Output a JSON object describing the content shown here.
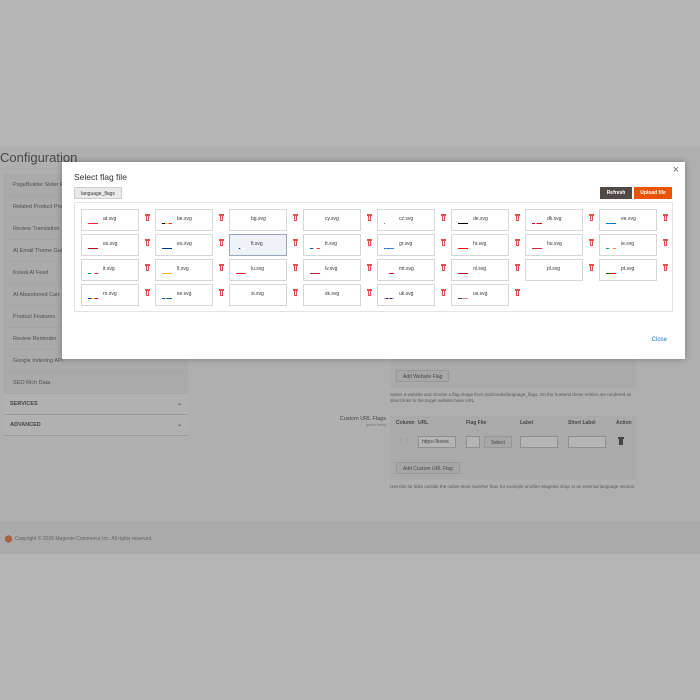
{
  "page": {
    "title": "Configuration",
    "sidebar_items": [
      "PageBuilder Slider F",
      "Related Product Pro",
      "Review Translation",
      "AI Email Theme Gen",
      "Kowal AI Feed",
      "AI Abandoned Cart",
      "Product Features",
      "Review Reminder",
      "Google Indexing API",
      "SEO Rich Data"
    ],
    "sidebar_sections": [
      "SERVICES",
      "ADVANCED"
    ],
    "add_website_flag": "Add Website Flag",
    "website_flag_hint": "Select a website and choose a flag image from pub/media/language_flags. On the frontend these entries are rendered as direct links to the target website base URL.",
    "custom_flags_label": "Custom URL Flags",
    "custom_flags_scope": "[store view]",
    "table_headers": [
      "Column",
      "URL",
      "Flag File",
      "Label",
      "Short Label",
      "Action"
    ],
    "url_value": "https://kowa",
    "select_label": "Select",
    "add_custom_flag": "Add Custom URL Flag",
    "custom_flag_hint": "Use this for links outside the native store switcher flow, for example another Magento shop or an external language version.",
    "copyright": "Copyright © 2026 Magento Commerce Inc. All rights reserved."
  },
  "modal": {
    "title": "Select flag file",
    "folder": "language_flags",
    "refresh_label": "Refresh",
    "upload_label": "Upload file",
    "close_label": "Close",
    "close_icon": "×",
    "selected_file": "fi.svg",
    "files": [
      {
        "name": "at.svg",
        "flag": "at"
      },
      {
        "name": "be.svg",
        "flag": "be"
      },
      {
        "name": "bg.svg",
        "flag": "bg"
      },
      {
        "name": "cy.svg",
        "flag": "cy"
      },
      {
        "name": "cz.svg",
        "flag": "cz"
      },
      {
        "name": "de.svg",
        "flag": "de"
      },
      {
        "name": "dk.svg",
        "flag": "dk"
      },
      {
        "name": "ee.svg",
        "flag": "ee"
      },
      {
        "name": "es.svg",
        "flag": "es"
      },
      {
        "name": "eu.svg",
        "flag": "eu"
      },
      {
        "name": "fi.svg",
        "flag": "fi"
      },
      {
        "name": "fr.svg",
        "flag": "fr"
      },
      {
        "name": "gr.svg",
        "flag": "gr"
      },
      {
        "name": "hr.svg",
        "flag": "hr"
      },
      {
        "name": "hu.svg",
        "flag": "hu"
      },
      {
        "name": "ie.svg",
        "flag": "ie"
      },
      {
        "name": "it.svg",
        "flag": "it"
      },
      {
        "name": "lt.svg",
        "flag": "lt"
      },
      {
        "name": "lu.svg",
        "flag": "lu"
      },
      {
        "name": "lv.svg",
        "flag": "lv"
      },
      {
        "name": "mt.svg",
        "flag": "mt"
      },
      {
        "name": "nl.svg",
        "flag": "nl"
      },
      {
        "name": "pl.svg",
        "flag": "pl"
      },
      {
        "name": "pt.svg",
        "flag": "pt"
      },
      {
        "name": "ro.svg",
        "flag": "ro"
      },
      {
        "name": "se.svg",
        "flag": "se"
      },
      {
        "name": "si.svg",
        "flag": "si"
      },
      {
        "name": "sk.svg",
        "flag": "sk"
      },
      {
        "name": "uk.svg",
        "flag": "uk"
      },
      {
        "name": "us.svg",
        "flag": "us"
      }
    ]
  },
  "colors": {
    "primary_button": "#eb5202",
    "secondary_button": "#514943",
    "link": "#1979c3",
    "delete_icon": "#d9534f"
  }
}
